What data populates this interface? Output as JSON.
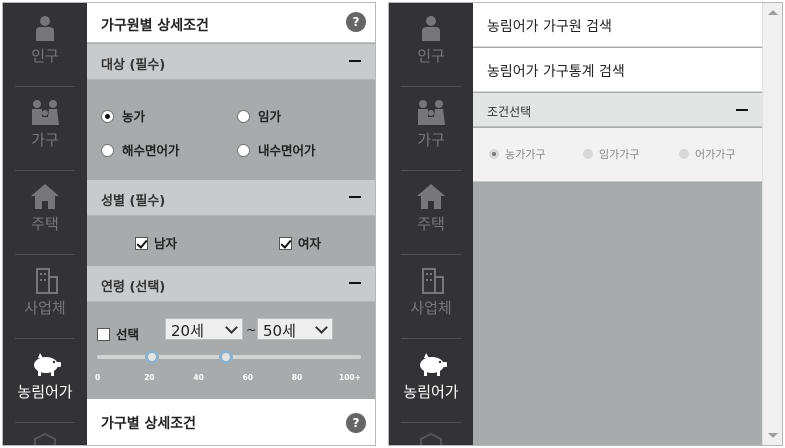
{
  "nav": {
    "items": [
      {
        "label": "인구",
        "icon": "person-icon"
      },
      {
        "label": "가구",
        "icon": "family-icon"
      },
      {
        "label": "주택",
        "icon": "house-icon"
      },
      {
        "label": "사업체",
        "icon": "building-icon"
      },
      {
        "label": "농림어가",
        "icon": "pig-icon"
      }
    ]
  },
  "left": {
    "title": "가구원별 상세조건",
    "help_label": "?",
    "target": {
      "header": "대상 (필수)",
      "options": [
        "농가",
        "임가",
        "해수면어가",
        "내수면어가"
      ],
      "selected": "농가"
    },
    "gender": {
      "header": "성별 (필수)",
      "options": [
        "남자",
        "여자"
      ]
    },
    "age": {
      "header": "연령 (선택)",
      "checkbox_label": "선택",
      "from": "20세",
      "separator": "~",
      "to": "50세",
      "slider_min": 20,
      "slider_max": 50,
      "ticks": [
        "0",
        "20",
        "40",
        "60",
        "80",
        "100+"
      ]
    },
    "household_title": "가구별 상세조건",
    "household_help": "?"
  },
  "right": {
    "search_member": "농림어가 가구원 검색",
    "search_stats": "농림어가 가구통계 검색",
    "condition_header": "조건선택",
    "options": [
      "농가가구",
      "임가가구",
      "어가가구"
    ],
    "selected": "농가가구"
  },
  "colors": {
    "nav_bg": "#333337",
    "panel_bg": "#a7abab",
    "slider_handle_ring": "#8fb0c8"
  }
}
